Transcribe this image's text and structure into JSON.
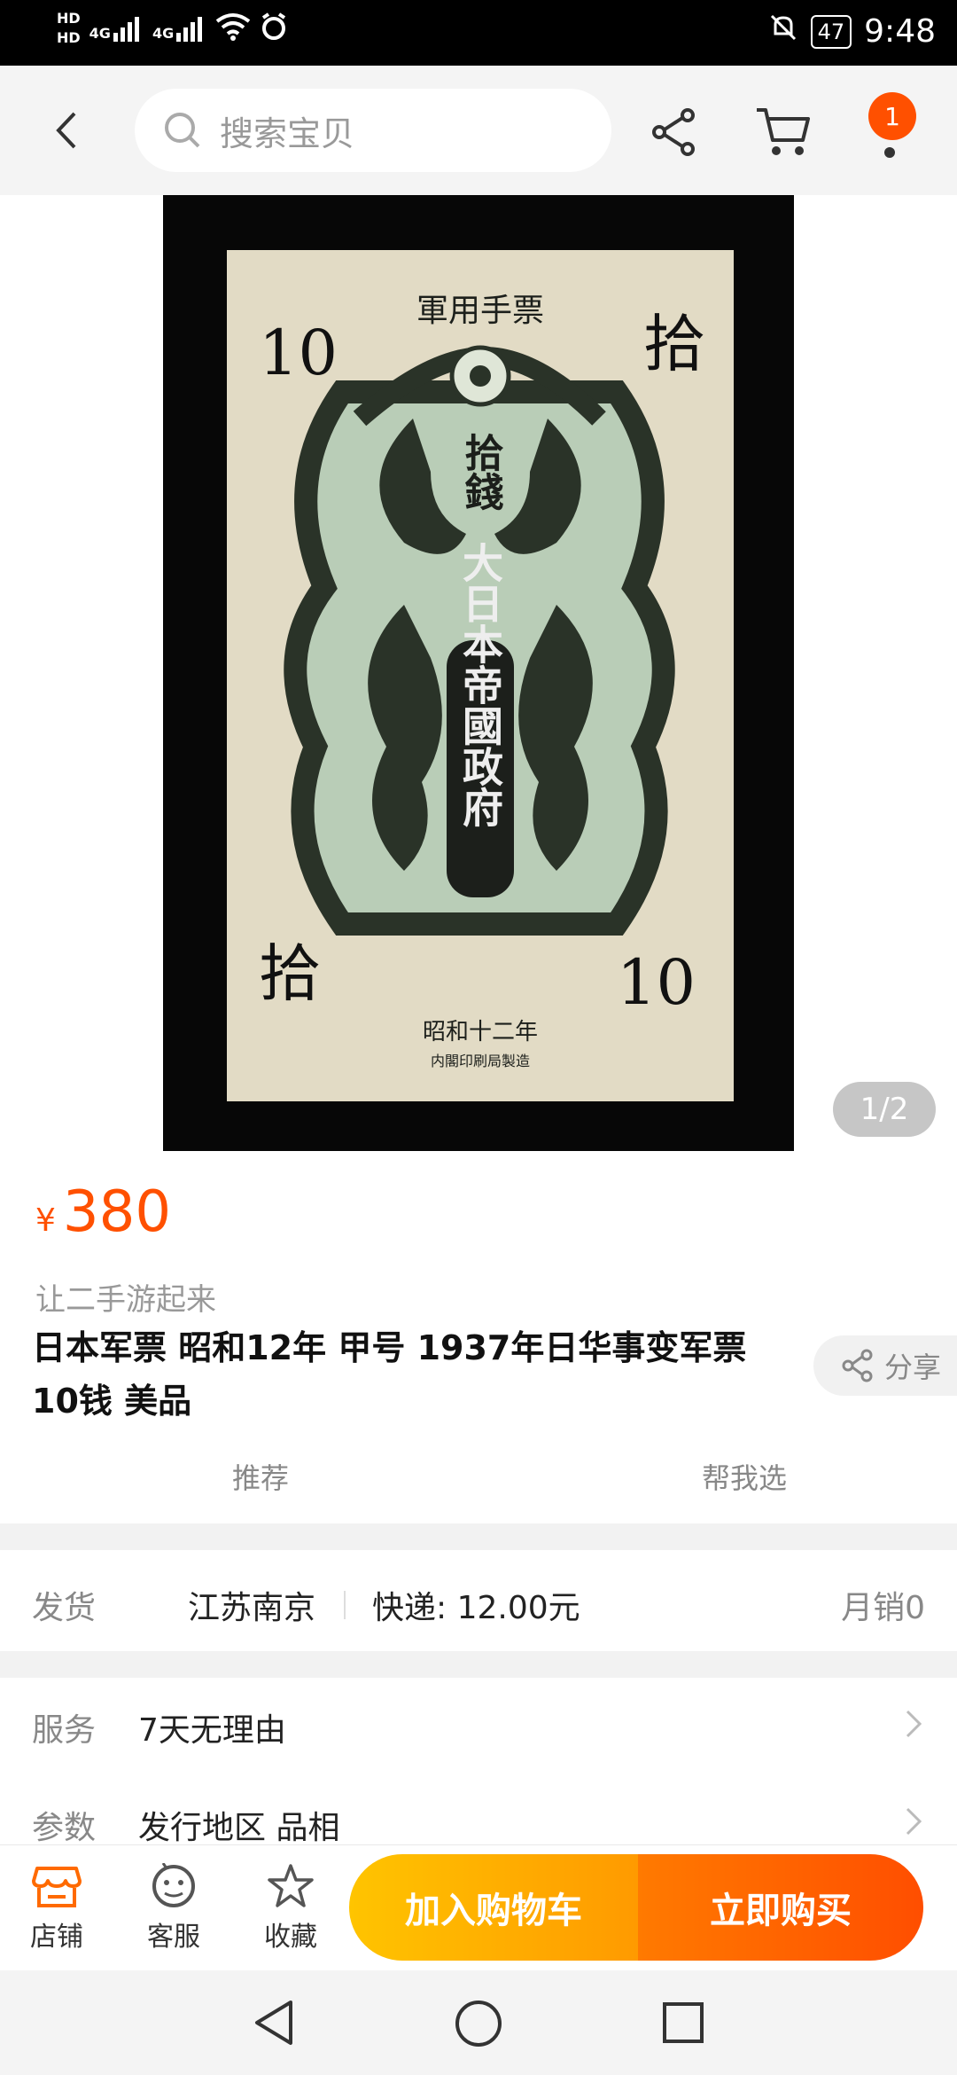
{
  "status_bar": {
    "time": "9:48",
    "battery": "47",
    "hd1": "HD",
    "hd2": "HD",
    "net1": "4G",
    "net2": "4G",
    "icons": [
      "signal-icon",
      "wifi-icon",
      "alarm-icon",
      "mute-bell-icon",
      "battery-icon"
    ]
  },
  "nav": {
    "search_placeholder": "搜索宝贝",
    "notification_count": "1",
    "icons": [
      "back-icon",
      "search-icon",
      "share-icon",
      "cart-icon",
      "more-icon"
    ]
  },
  "gallery": {
    "pager": "1/2",
    "banknote_text": {
      "header": "軍用手票",
      "denomination_left": "10",
      "denomination_right": "拾",
      "center": "拾錢",
      "vertical": "大日本帝國政府",
      "era": "昭和十二年",
      "printer": "内閣印刷局製造"
    }
  },
  "product": {
    "currency": "¥",
    "price": "380",
    "slogan": "让二手游起来",
    "title": "日本军票 昭和12年 甲号 1937年日华事变军票10钱 美品",
    "share_label": "分享",
    "tab_recommend": "推荐",
    "tab_help": "帮我选"
  },
  "shipping": {
    "label": "发货",
    "from": "江苏南京",
    "fee": "快递: 12.00元",
    "monthly_sales": "月销0"
  },
  "service": {
    "label": "服务",
    "value": "7天无理由",
    "params_label": "参数",
    "params_value": "发行地区 品相"
  },
  "bottom": {
    "shop": "店铺",
    "service": "客服",
    "favorite": "收藏",
    "add_cart": "加入购物车",
    "buy_now": "立即购买"
  },
  "colors": {
    "accent": "#ff5000",
    "cart_button": "#ffb300",
    "buy_button": "#ff5a00"
  }
}
